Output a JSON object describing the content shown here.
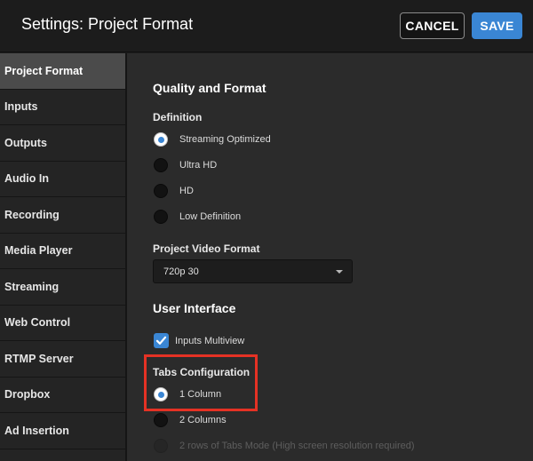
{
  "header": {
    "title": "Settings: Project Format",
    "cancel_label": "CANCEL",
    "save_label": "SAVE"
  },
  "sidebar": {
    "items": [
      {
        "label": "Project Format",
        "active": true
      },
      {
        "label": "Inputs"
      },
      {
        "label": "Outputs"
      },
      {
        "label": "Audio In"
      },
      {
        "label": "Recording"
      },
      {
        "label": "Media Player"
      },
      {
        "label": "Streaming"
      },
      {
        "label": "Web Control"
      },
      {
        "label": "RTMP Server"
      },
      {
        "label": "Dropbox"
      },
      {
        "label": "Ad Insertion"
      }
    ]
  },
  "main": {
    "quality_title": "Quality and Format",
    "definition_label": "Definition",
    "definition_options": [
      {
        "label": "Streaming Optimized",
        "selected": true
      },
      {
        "label": "Ultra HD"
      },
      {
        "label": "HD"
      },
      {
        "label": "Low Definition"
      }
    ],
    "video_format_label": "Project Video Format",
    "video_format_value": "720p 30",
    "ui_title": "User Interface",
    "inputs_multiview_label": "Inputs Multiview",
    "inputs_multiview_checked": true,
    "tabs_config_label": "Tabs Configuration",
    "tabs_options": [
      {
        "label": "1 Column",
        "selected": true
      },
      {
        "label": "2 Columns"
      },
      {
        "label": "2 rows of Tabs Mode (High screen resolution required)",
        "disabled": true
      }
    ]
  },
  "colors": {
    "accent": "#3a86d4",
    "highlight": "#e53224",
    "background": "#2b2b2b",
    "sidebar": "#242424",
    "sidebar_active": "#4b4b4b"
  }
}
